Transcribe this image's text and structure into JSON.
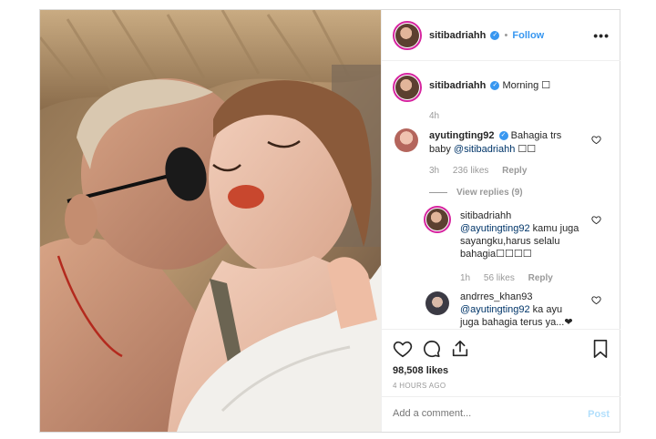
{
  "header": {
    "username": "sitibadriahh",
    "verified_mark": "✓",
    "follow_label": "Follow",
    "separator": "•",
    "more_label": "•••"
  },
  "caption": {
    "username": "sitibadriahh",
    "text": "Morning ☐",
    "time": "4h"
  },
  "comments": [
    {
      "username": "ayutingting92",
      "text": "Bahagia trs",
      "text2_prefix": "baby ",
      "mention": "@sitibadriahh",
      "text2_suffix": " ☐☐",
      "time": "3h",
      "likes": "236 likes",
      "reply_label": "Reply",
      "view_replies": "View replies (9)"
    },
    {
      "username": "sitibadriahh",
      "mention": "@ayutingting92",
      "text1": " kamu juga",
      "text2": "sayangku,harus selalu",
      "text3": "bahagia☐☐☐☐",
      "time": "1h",
      "likes": "56 likes",
      "reply_label": "Reply"
    },
    {
      "username": "andrres_khan93",
      "mention": "@ayutingting92",
      "text1": " ka ayu",
      "text2": "juga bahagia terus ya...❤"
    }
  ],
  "stats": {
    "likes": "98,508 likes",
    "timestamp": "4 HOURS AGO"
  },
  "add_comment": {
    "placeholder": "Add a comment...",
    "post_label": "Post"
  },
  "colors": {
    "accent_blue": "#3897f0",
    "link": "#003569",
    "muted": "#999999",
    "ring": "#d6249f"
  }
}
